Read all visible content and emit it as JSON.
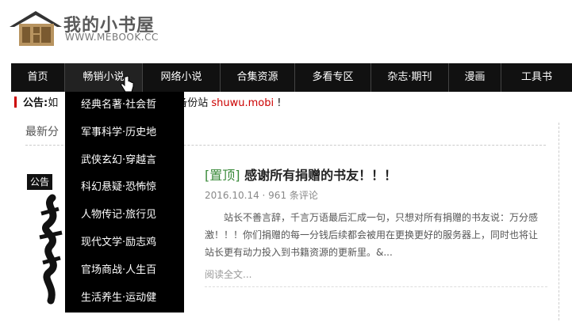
{
  "header": {
    "logo_text": "我的小书屋",
    "logo_url": "WWW.MEBOOK.CC"
  },
  "nav": {
    "items": [
      {
        "label": "首页"
      },
      {
        "label": "畅销小说"
      },
      {
        "label": "网络小说"
      },
      {
        "label": "合集资源"
      },
      {
        "label": "多看专区"
      },
      {
        "label": "杂志·期刊"
      },
      {
        "label": "漫画"
      },
      {
        "label": "工具书"
      }
    ]
  },
  "notice": {
    "label": "公告:",
    "text_before": "如",
    "text_after": "备份站",
    "highlight": "shuwu.mobi",
    "suffix": "!"
  },
  "main": {
    "latest_title": "最新分",
    "badge": "公告",
    "post": {
      "tag": "[置顶]",
      "title": "感谢所有捐赠的书友！！！",
      "date": "2016.10.14",
      "comments": "961 条评论",
      "excerpt": "站长不善言辞，千言万语最后汇成一句，只想对所有捐赠的书友说：万分感激！！！你们捐赠的每一分钱后续都会被用在更换更好的服务器上，同时也将让站长更有动力投入到书籍资源的更新里。&...",
      "read_more": "阅读全文..."
    }
  },
  "dropdown": {
    "items": [
      {
        "label": "经典名著·社会哲"
      },
      {
        "label": "军事科学·历史地"
      },
      {
        "label": "武侠玄幻·穿越言"
      },
      {
        "label": "科幻悬疑·恐怖惊"
      },
      {
        "label": "人物传记·旅行见"
      },
      {
        "label": "现代文学·励志鸡"
      },
      {
        "label": "官场商战·人生百"
      },
      {
        "label": "生活养生·运动健"
      }
    ]
  }
}
